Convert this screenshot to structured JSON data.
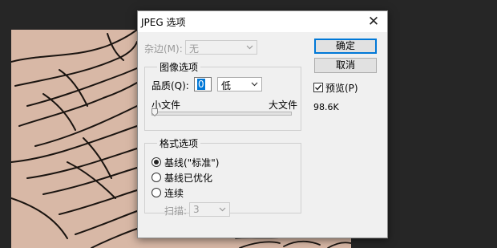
{
  "dialog": {
    "title": "JPEG 选项",
    "matte": {
      "label": "杂边(M):",
      "value": "无"
    },
    "image_options": {
      "group_title": "图像选项",
      "quality_label": "品质(Q):",
      "quality_value": "0",
      "quality_preset": "低",
      "small_file_label": "小文件",
      "large_file_label": "大文件",
      "quality_slider_fraction": 0
    },
    "format_options": {
      "group_title": "格式选项",
      "options": [
        {
          "label": "基线(\"标准\")",
          "selected": true
        },
        {
          "label": "基线已优化",
          "selected": false
        },
        {
          "label": "连续",
          "selected": false
        }
      ],
      "scans_label": "扫描:",
      "scans_value": "3"
    },
    "buttons": {
      "ok": "确定",
      "cancel": "取消"
    },
    "preview": {
      "label": "预览(P)",
      "checked": true
    },
    "file_size": "98.6K"
  }
}
